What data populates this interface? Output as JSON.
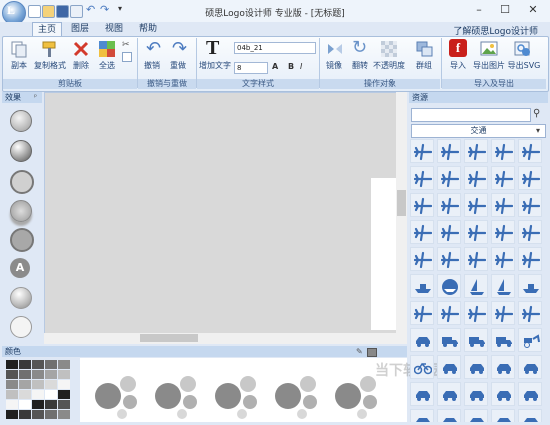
{
  "window": {
    "title": "硕思Logo设计师 专业版 - [无标题]",
    "controls": [
      "–",
      "☐",
      "✕"
    ]
  },
  "tabs": [
    {
      "label": "主页",
      "active": true
    },
    {
      "label": "图层",
      "active": false
    },
    {
      "label": "视图",
      "active": false
    },
    {
      "label": "帮助",
      "active": false
    }
  ],
  "learn_link": "了解硕思Logo设计师",
  "ribbon": {
    "clipboard": {
      "label": "剪贴板",
      "buttons": [
        "副本",
        "复制格式",
        "删除",
        "全选"
      ]
    },
    "undo": {
      "label": "撤销与重做",
      "buttons": [
        "撤销",
        "重做"
      ]
    },
    "text_style": {
      "label": "文字样式",
      "add_text": "增加文字",
      "font_value": "04b_21",
      "size_value": "8",
      "format_buttons": [
        "A",
        "B",
        "I"
      ]
    },
    "operate": {
      "label": "操作对象",
      "buttons": [
        "镜像",
        "翻转",
        "不透明度",
        "群组"
      ]
    },
    "import_export": {
      "label": "导入及导出",
      "buttons": [
        "导入",
        "导出图片",
        "导出SVG"
      ]
    }
  },
  "panels": {
    "effects": "效果",
    "colors": "颜色",
    "resources": "资源",
    "resource_category": "交通",
    "search_placeholder": ""
  },
  "effect_icon_letter": "A",
  "watermark": "当下软件园",
  "icons": {
    "clipboard": [
      "copy-icon",
      "format-painter-icon",
      "delete-icon",
      "select-all-icon"
    ],
    "undo": [
      "undo-icon",
      "redo-icon"
    ],
    "operate": [
      "mirror-icon",
      "rotate-icon",
      "opacity-icon",
      "group-icon"
    ],
    "import_export": [
      "import-flash-icon",
      "export-image-icon",
      "export-svg-icon"
    ]
  },
  "resource_rows": [
    [
      "airplane",
      "airplane",
      "airplane",
      "airplane",
      "airplane"
    ],
    [
      "airplane",
      "airplane",
      "airplane",
      "airplane",
      "airplane"
    ],
    [
      "airplane",
      "airplane",
      "airplane",
      "airplane",
      "airplane"
    ],
    [
      "airplane",
      "airplane",
      "airplane",
      "airplane",
      "airplane"
    ],
    [
      "airplane",
      "airplane",
      "airplane",
      "airplane",
      "airplane"
    ],
    [
      "ship",
      "boat",
      "sailboat",
      "sailboat",
      "ship"
    ],
    [
      "airplane",
      "airplane",
      "airplane",
      "airplane",
      "airplane"
    ],
    [
      "car",
      "truck",
      "truck",
      "truck",
      "carriage"
    ],
    [
      "bicycle",
      "car",
      "car",
      "car",
      "car"
    ],
    [
      "car",
      "car",
      "car",
      "car",
      "car"
    ],
    [
      "car",
      "car",
      "car",
      "car",
      "car"
    ]
  ]
}
